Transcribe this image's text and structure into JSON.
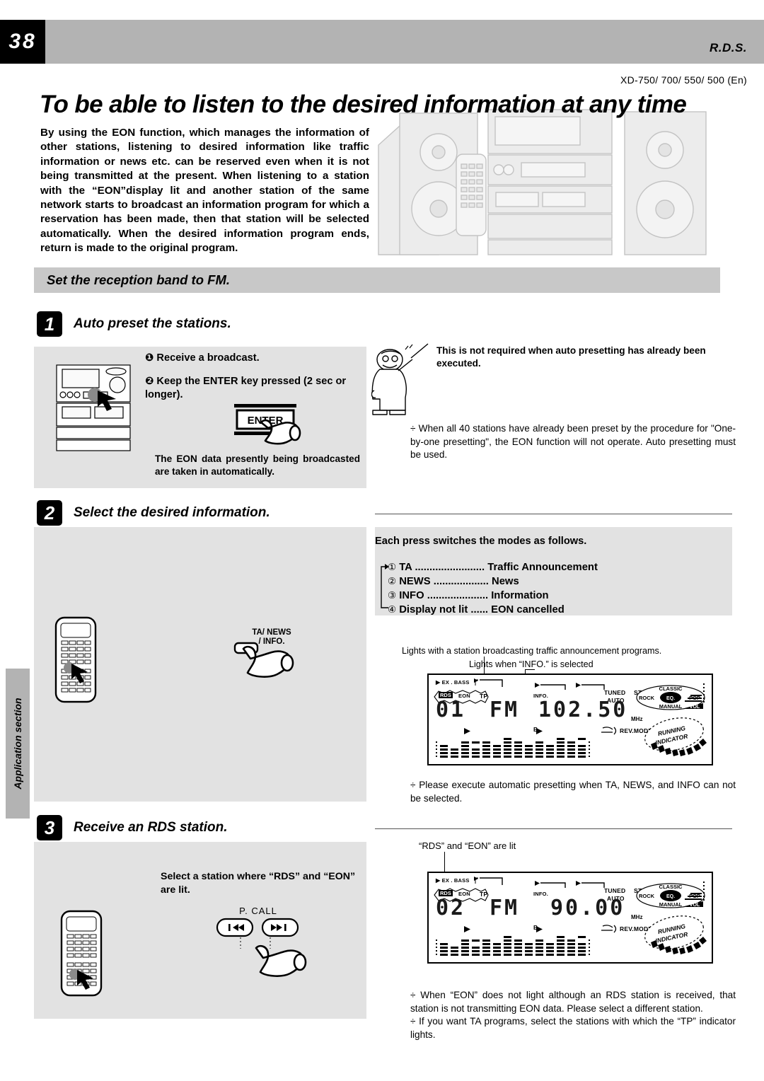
{
  "header": {
    "page_number": "38",
    "section_label": "R.D.S.",
    "model_line": "XD-750/ 700/ 550/ 500 (En)",
    "side_tab": "Application section"
  },
  "title": "To be able to listen to the desired information at any time",
  "intro": "By using the EON function, which manages the information of other stations, listening to desired information like traffic information or news etc. can be reserved even when it is not being transmitted at the present. When listening to a station with the “EON”display lit and another station of the same network starts to broadcast an information program for which a reservation has been made, then that station will be selected automatically. When the desired information program ends, return is made to the original program.",
  "band_bar": "Set the reception band to FM.",
  "step1": {
    "number": "1",
    "title": "Auto preset the stations.",
    "bullet1": "Receive a broadcast.",
    "bullet2": "Keep the ENTER key pressed (2 sec or longer).",
    "enter_key_label": "ENTER",
    "caption": "The EON data presently being broadcasted are taken in automatically.",
    "right_bold": "This is not required when auto presetting has already been executed.",
    "right_note": "When all 40 stations have already been preset by the procedure for \"One-by-one presetting\", the EON function will not operate. Auto presetting must be used."
  },
  "step2": {
    "number": "2",
    "title": "Select the desired information.",
    "each_press": "Each press switches the modes as follows.",
    "button_label_line1": "TA/ NEWS",
    "button_label_line2": "/ INFO.",
    "modes": [
      {
        "num": "①",
        "key": "TA",
        "dots": "........................",
        "desc": "Traffic Announcement"
      },
      {
        "num": "②",
        "key": "NEWS",
        "dots": "...................",
        "desc": "News"
      },
      {
        "num": "③",
        "key": "INFO",
        "dots": ".....................",
        "desc": "Information"
      },
      {
        "num": "④",
        "key": "Display not lit",
        "dots": "......",
        "desc": "EON cancelled"
      }
    ],
    "lcd_note_1": "Lights with a station broadcasting traffic announcement programs.",
    "lcd_note_2": "Lights when “INFO.” is selected",
    "note": "Please execute automatic presetting when TA, NEWS, and INFO can not be selected."
  },
  "step3": {
    "number": "3",
    "title": "Receive an RDS station.",
    "caption": "Select a station where “RDS” and “EON” are lit.",
    "pcall_label": "P. CALL",
    "lcd_note": "“RDS” and “EON” are lit",
    "note1": "When “EON” does not light although an RDS station is received, that station is not transmitting EON data. Please select a different station.",
    "note2": "If you want TA programs, select the stations with which the “TP” indicator lights."
  },
  "lcd_display_1": {
    "preset": "01",
    "band": "FM",
    "frequency": "102.50",
    "unit": "MHz",
    "labels": {
      "ex_bass": "EX . BASS",
      "rds": "RDS",
      "eon": "EON",
      "tp": "TP",
      "info": "INFO.",
      "tuned": "TUNED",
      "stereo": "STEREO",
      "auto": "AUTO",
      "b_mark": "B",
      "rev_mode": "REV.MODE",
      "classic": "CLASSIC",
      "rock": "ROCK",
      "eq": "EQ.",
      "pop": "POP",
      "manual": "MANUAL",
      "vol": "VOL",
      "running_1": "RUNNING",
      "running_2": "INDICATOR"
    }
  },
  "lcd_display_2": {
    "preset": "02",
    "band": "FM",
    "frequency": "90.00",
    "unit": "MHz",
    "labels": {
      "ex_bass": "EX . BASS",
      "rds": "RDS",
      "eon": "EON",
      "tp": "TP",
      "info": "INFO.",
      "tuned": "TUNED",
      "stereo": "STEREO",
      "auto": "AUTO",
      "b_mark": "B",
      "rev_mode": "REV.MODE",
      "classic": "CLASSIC",
      "rock": "ROCK",
      "eq": "EQ.",
      "pop": "POP",
      "manual": "MANUAL",
      "vol": "VOL",
      "running_1": "RUNNING",
      "running_2": "INDICATOR"
    }
  },
  "colors": {
    "header_band": "#b3b3b3",
    "box_gray": "#e2e2e2",
    "band_bar": "#c8c8c8",
    "black": "#000000"
  }
}
